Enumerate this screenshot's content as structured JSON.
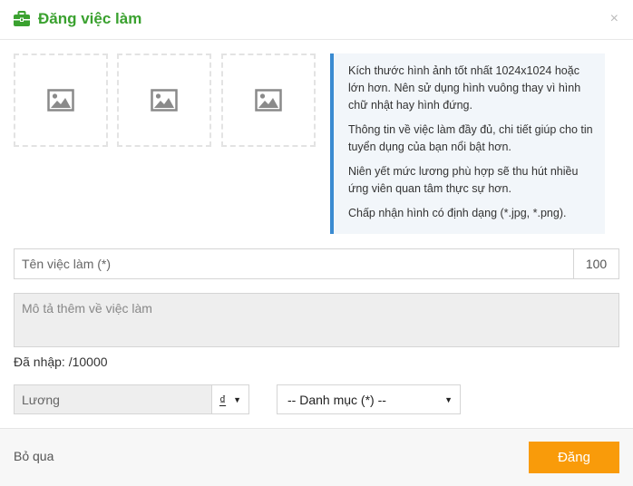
{
  "header": {
    "title": "Đăng việc làm",
    "close_label": "×",
    "icon": "briefcase-icon",
    "title_color": "#3aa12f"
  },
  "images": {
    "slots": [
      "image-placeholder-icon",
      "image-placeholder-icon",
      "image-placeholder-icon"
    ]
  },
  "tips": {
    "items": [
      "Kích thước hình ảnh tốt nhất 1024x1024 hoặc lớn hơn. Nên sử dụng hình vuông thay vì hình chữ nhật hay hình đứng.",
      "Thông tin về việc làm đầy đủ, chi tiết giúp cho tin tuyển dụng của bạn nổi bật hơn.",
      "Niên yết mức lương phù hợp sẽ thu hút nhiều ứng viên quan tâm thực sự hơn.",
      "Chấp nhận hình có định dạng (*.jpg, *.png)."
    ],
    "accent_color": "#3b8bd1"
  },
  "form": {
    "job_title_placeholder": "Tên việc làm (*)",
    "job_title_value": "",
    "job_title_counter": "100",
    "description_placeholder": "Mô tả thêm về việc làm",
    "description_value": "",
    "typed_count_label": "Đã nhập: /10000",
    "salary_placeholder": "Lương",
    "salary_value": "",
    "currency": "₫",
    "category_selected": "-- Danh mục (*) --"
  },
  "footer": {
    "skip_label": "Bỏ qua",
    "submit_label": "Đăng",
    "submit_color": "#f99b0a"
  }
}
